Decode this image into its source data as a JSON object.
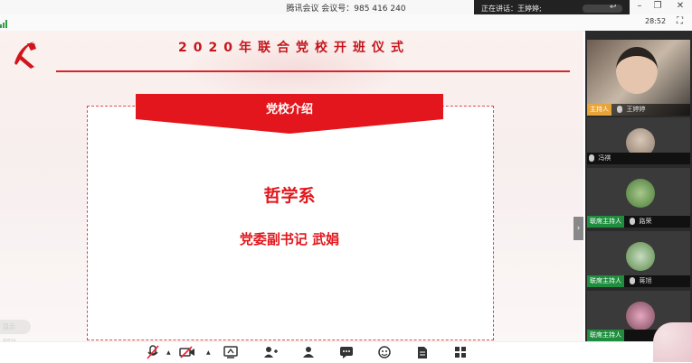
{
  "app": {
    "title": "腾讯会议 会议号：985 416 240",
    "speaking_label": "正在讲话：王婷婷;",
    "timer": "28:52"
  },
  "slide": {
    "title": "2020年联合党校开班仪式",
    "banner": "党校介绍",
    "department": "哲学系",
    "person": "党委副书记   武娟",
    "zoom_chip": "显示 95%"
  },
  "participants": [
    {
      "role_tag": "主持人",
      "name": "王婷婷"
    },
    {
      "role_tag": "",
      "name": "冯祺"
    },
    {
      "role_tag": "联席主持人",
      "name": "路荣"
    },
    {
      "role_tag": "联席主持人",
      "name": "蒋旭"
    },
    {
      "role_tag": "联席主持人",
      "name": ""
    }
  ],
  "toolbar": {
    "icons": [
      "mic-muted-icon",
      "camera-muted-icon",
      "screen-share-icon",
      "invite-icon",
      "members-icon",
      "chat-icon",
      "reactions-icon",
      "document-icon",
      "apps-icon"
    ]
  },
  "colors": {
    "accent_red": "#e2161c",
    "host_tag": "#e7a43a",
    "cohost_tag": "#1e8e3e"
  }
}
